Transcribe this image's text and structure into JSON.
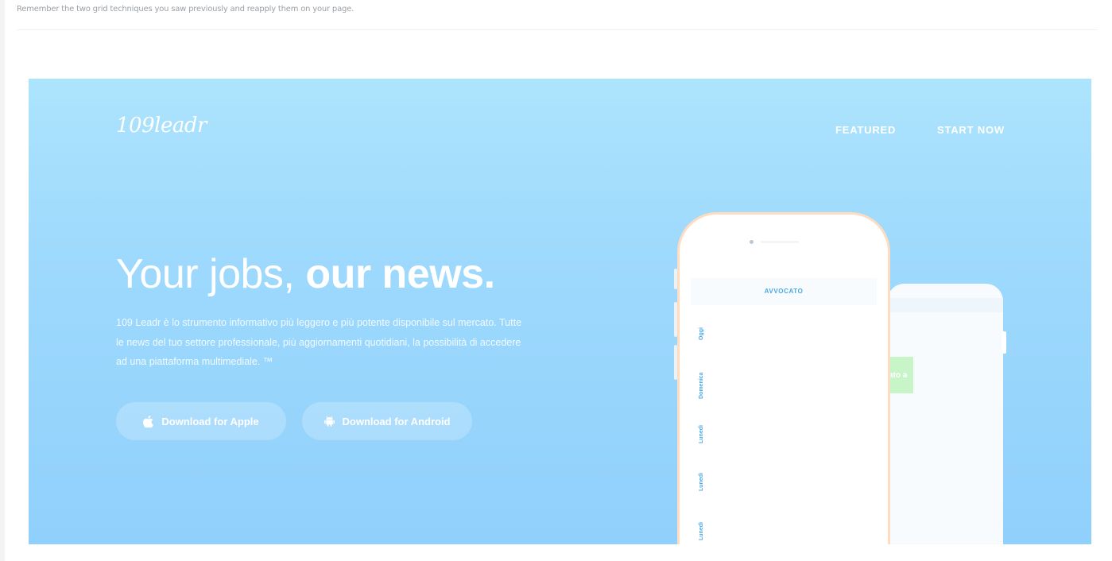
{
  "instruction": "Remember the two grid techniques you saw previously and reapply them on your page.",
  "hero": {
    "logo": "109leadr",
    "nav": {
      "featured": "FEATURED",
      "start_now": "START NOW"
    },
    "headline_light": "Your jobs, ",
    "headline_bold": "our news.",
    "description": "109 Leadr è lo strumento informativo più leggero e più potente disponibile sul mercato. Tutte le news del tuo settore professionale, più aggiornamenti quotidiani, la possibilità di accedere ad una piattaforma multimediale. ™",
    "buttons": {
      "apple": {
        "label": "Download for Apple",
        "icon": "apple-icon"
      },
      "android": {
        "label": "Download for Android",
        "icon": "android-icon"
      }
    },
    "phone": {
      "screen_title": "AVVOCATO",
      "days": [
        "Oggi",
        "Domenica",
        "Lunedì",
        "Lunedì",
        "Lunedì"
      ],
      "back_tag": "ato a"
    }
  },
  "colors": {
    "hero_top": "#ade4fd",
    "hero_bottom": "#90d0fc",
    "accent_text": "#4aa8e4",
    "phone_border": "#ffdcc0",
    "tag_green": "#c8f5c8"
  }
}
